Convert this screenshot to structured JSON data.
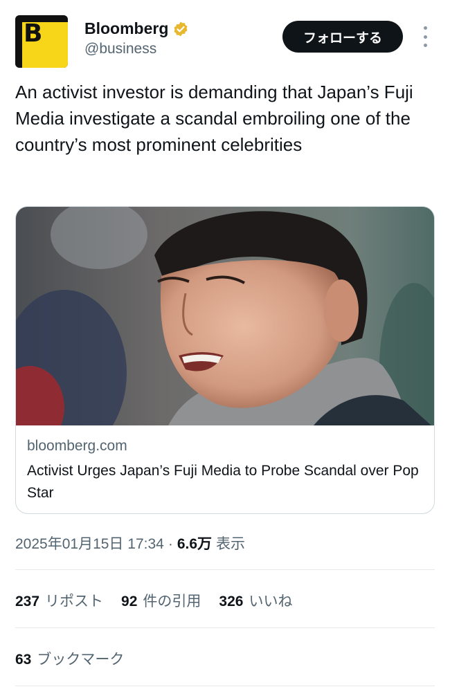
{
  "account": {
    "avatar_letter": "B",
    "display_name": "Bloomberg",
    "handle": "@business",
    "verified_badge_color": "#e8b730",
    "follow_label": "フォローする"
  },
  "tweet": {
    "text": "An activist investor is demanding that Japan’s Fuji Media investigate a scandal embroiling one of the country’s most prominent celebrities"
  },
  "card": {
    "image_desc": "photo-man-smiling-grey-scarf",
    "domain": "bloomberg.com",
    "title": "Activist Urges Japan’s Fuji Media to Probe Scandal over Pop Star"
  },
  "meta": {
    "timestamp": "2025年01月15日 17:34",
    "separator": "·",
    "views_count": "6.6万",
    "views_label": "表示"
  },
  "stats": {
    "reposts_count": "237",
    "reposts_label": "リポスト",
    "quotes_count": "92",
    "quotes_label": "件の引用",
    "likes_count": "326",
    "likes_label": "いいね",
    "bookmarks_count": "63",
    "bookmarks_label": "ブックマーク"
  },
  "colors": {
    "text_primary": "#0f1419",
    "text_secondary": "#536471",
    "divider": "#e7e9ea",
    "brand_yellow": "#f7d61a"
  }
}
